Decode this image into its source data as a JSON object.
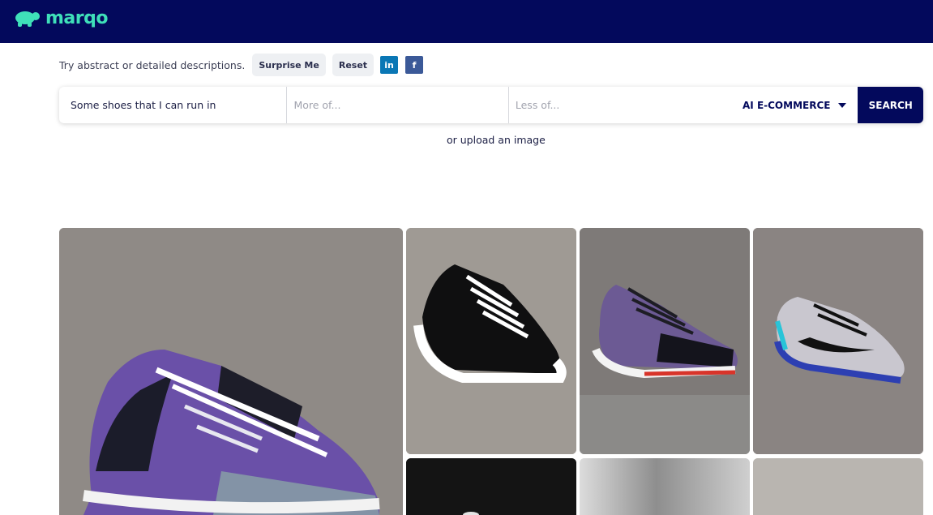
{
  "brand": {
    "name": "marqo"
  },
  "hint": {
    "text": "Try abstract or detailed descriptions.",
    "surprise_label": "Surprise Me",
    "reset_label": "Reset",
    "linkedin_label": "in",
    "facebook_label": "f"
  },
  "search": {
    "query_value": "Some shoes that I can run in",
    "more_placeholder": "More of...",
    "less_placeholder": "Less of...",
    "mode_label": "AI E-COMMERCE",
    "button_label": "SEARCH"
  },
  "upload_link": "or upload an image",
  "colors": {
    "navy": "#03095c",
    "accent": "#3fe0b9"
  },
  "results": [
    {
      "icon": "purple-black-running-shoe-image"
    },
    {
      "icon": "black-white-sneaker-image"
    },
    {
      "icon": "purple-black-shoe-red-sole-image"
    },
    {
      "icon": "white-blue-nike-shoe-image"
    },
    {
      "icon": "dark-shoe-image"
    },
    {
      "icon": "blurred-shoe-image"
    },
    {
      "icon": "grey-shoe-image"
    }
  ]
}
